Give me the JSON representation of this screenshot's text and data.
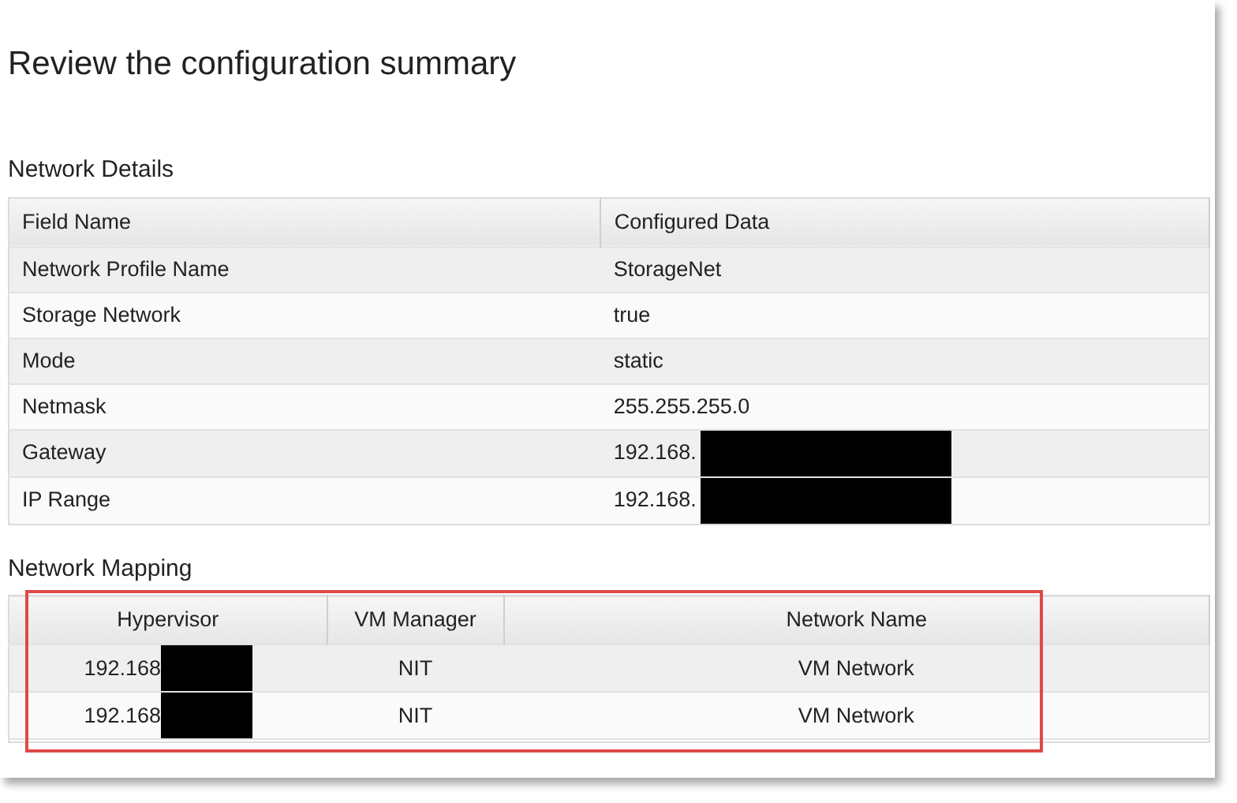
{
  "title": "Review the configuration summary",
  "network_details": {
    "heading": "Network Details",
    "kind": "plain",
    "highlighted": false,
    "columns": [
      "Field Name",
      "Configured Data"
    ],
    "rows": [
      {
        "cells": [
          {
            "text": "Network Profile Name"
          },
          {
            "text": "StorageNet"
          }
        ]
      },
      {
        "cells": [
          {
            "text": "Storage Network"
          },
          {
            "text": "true"
          }
        ]
      },
      {
        "cells": [
          {
            "text": "Mode"
          },
          {
            "text": "static"
          }
        ]
      },
      {
        "cells": [
          {
            "text": "Netmask"
          },
          {
            "text": "255.255.255.0"
          }
        ]
      },
      {
        "cells": [
          {
            "text": "Gateway"
          },
          {
            "text": "192.168.",
            "redacted": true
          }
        ]
      },
      {
        "cells": [
          {
            "text": "IP Range"
          },
          {
            "text": "192.168.",
            "redacted": true
          }
        ]
      }
    ]
  },
  "network_mapping": {
    "heading": "Network Mapping",
    "kind": "centered",
    "highlighted": true,
    "columns": [
      "Hypervisor",
      "VM Manager",
      "Network Name"
    ],
    "rows": [
      {
        "cells": [
          {
            "text": "192.168",
            "redacted": true
          },
          {
            "text": "NIT"
          },
          {
            "text": "VM Network"
          }
        ]
      },
      {
        "cells": [
          {
            "text": "192.168",
            "redacted": true
          },
          {
            "text": "NIT"
          },
          {
            "text": "VM Network"
          }
        ]
      }
    ]
  }
}
